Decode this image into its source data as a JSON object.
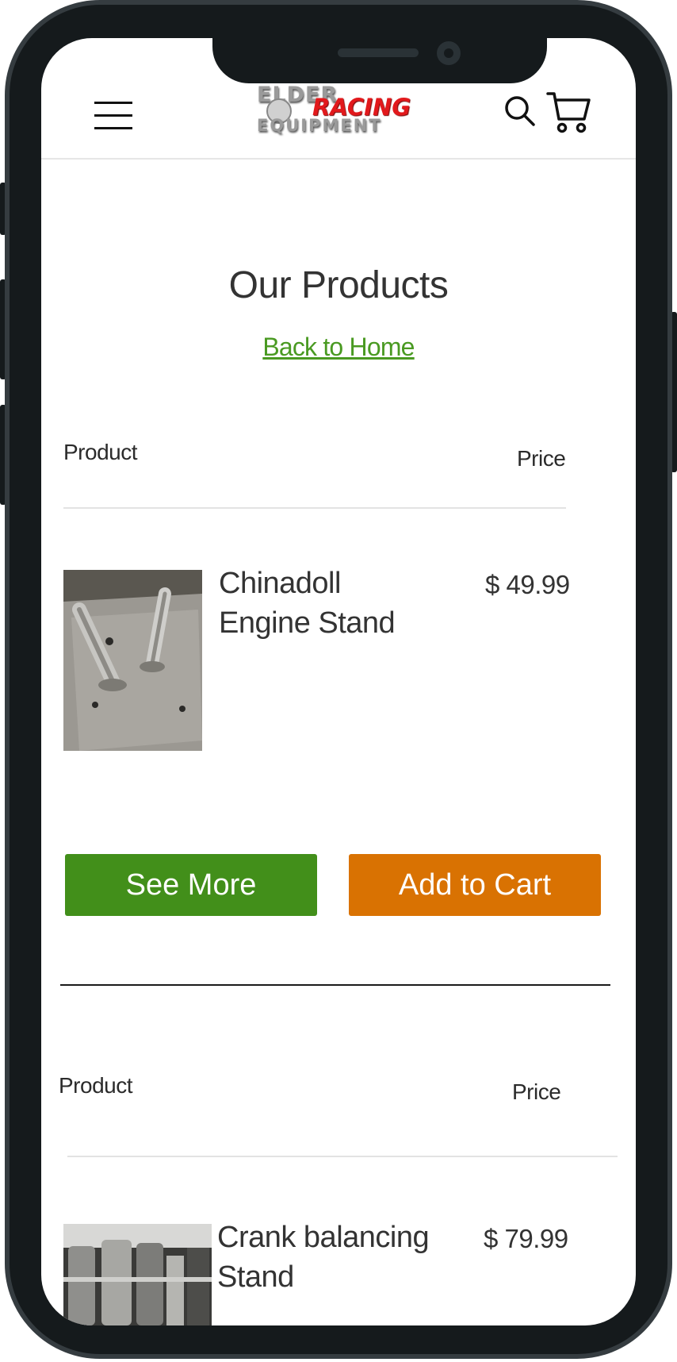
{
  "header": {
    "logo": {
      "line1": "ELDER",
      "line2": "RACING",
      "line3": "EQUIPMENT"
    },
    "icons": {
      "menu": "hamburger-menu-icon",
      "search": "search-icon",
      "cart": "cart-icon"
    }
  },
  "page": {
    "title": "Our Products",
    "back_link": "Back to Home"
  },
  "products": [
    {
      "column_product": "Product",
      "column_price": "Price",
      "name_line1": "Chinadoll",
      "name_line2": "Engine Stand",
      "price": "$ 49.99",
      "see_more_label": "See More",
      "add_to_cart_label": "Add to Cart"
    },
    {
      "column_product": "Product",
      "column_price": "Price",
      "name_line1": "Crank balancing",
      "name_line2": "Stand",
      "price": "$ 79.99"
    }
  ],
  "colors": {
    "accent_green": "#428f1a",
    "accent_orange": "#d97202",
    "link_green": "#4a9a22",
    "frame": "#151a1c"
  }
}
